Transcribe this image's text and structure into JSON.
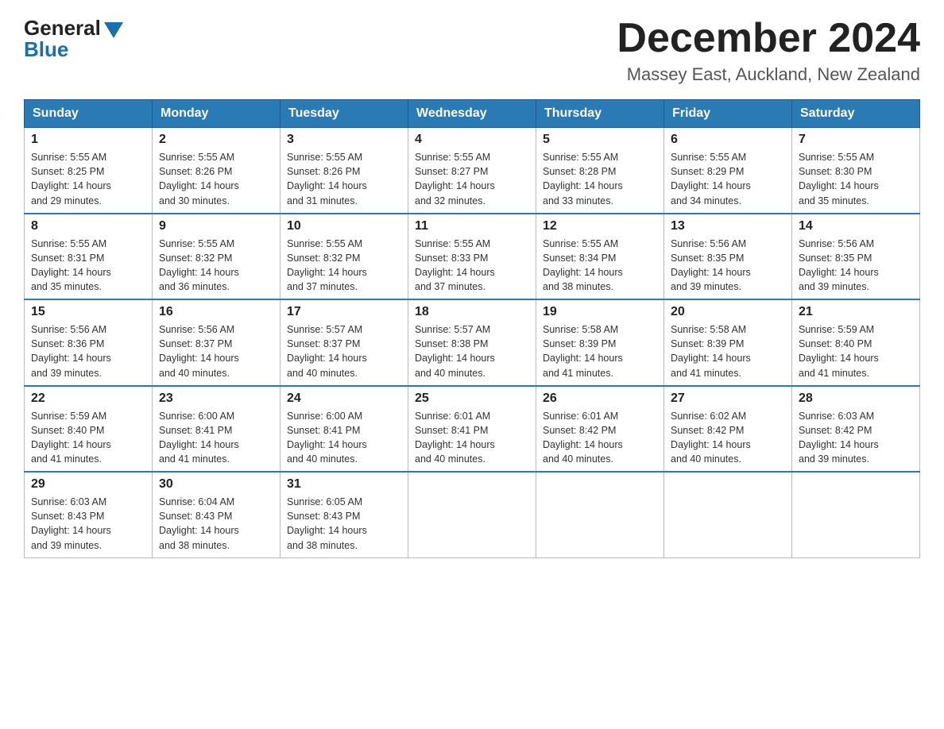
{
  "header": {
    "logo_general": "General",
    "logo_blue": "Blue",
    "main_title": "December 2024",
    "subtitle": "Massey East, Auckland, New Zealand"
  },
  "weekdays": [
    "Sunday",
    "Monday",
    "Tuesday",
    "Wednesday",
    "Thursday",
    "Friday",
    "Saturday"
  ],
  "weeks": [
    [
      {
        "day": "1",
        "sunrise": "5:55 AM",
        "sunset": "8:25 PM",
        "daylight": "14 hours and 29 minutes."
      },
      {
        "day": "2",
        "sunrise": "5:55 AM",
        "sunset": "8:26 PM",
        "daylight": "14 hours and 30 minutes."
      },
      {
        "day": "3",
        "sunrise": "5:55 AM",
        "sunset": "8:26 PM",
        "daylight": "14 hours and 31 minutes."
      },
      {
        "day": "4",
        "sunrise": "5:55 AM",
        "sunset": "8:27 PM",
        "daylight": "14 hours and 32 minutes."
      },
      {
        "day": "5",
        "sunrise": "5:55 AM",
        "sunset": "8:28 PM",
        "daylight": "14 hours and 33 minutes."
      },
      {
        "day": "6",
        "sunrise": "5:55 AM",
        "sunset": "8:29 PM",
        "daylight": "14 hours and 34 minutes."
      },
      {
        "day": "7",
        "sunrise": "5:55 AM",
        "sunset": "8:30 PM",
        "daylight": "14 hours and 35 minutes."
      }
    ],
    [
      {
        "day": "8",
        "sunrise": "5:55 AM",
        "sunset": "8:31 PM",
        "daylight": "14 hours and 35 minutes."
      },
      {
        "day": "9",
        "sunrise": "5:55 AM",
        "sunset": "8:32 PM",
        "daylight": "14 hours and 36 minutes."
      },
      {
        "day": "10",
        "sunrise": "5:55 AM",
        "sunset": "8:32 PM",
        "daylight": "14 hours and 37 minutes."
      },
      {
        "day": "11",
        "sunrise": "5:55 AM",
        "sunset": "8:33 PM",
        "daylight": "14 hours and 37 minutes."
      },
      {
        "day": "12",
        "sunrise": "5:55 AM",
        "sunset": "8:34 PM",
        "daylight": "14 hours and 38 minutes."
      },
      {
        "day": "13",
        "sunrise": "5:56 AM",
        "sunset": "8:35 PM",
        "daylight": "14 hours and 39 minutes."
      },
      {
        "day": "14",
        "sunrise": "5:56 AM",
        "sunset": "8:35 PM",
        "daylight": "14 hours and 39 minutes."
      }
    ],
    [
      {
        "day": "15",
        "sunrise": "5:56 AM",
        "sunset": "8:36 PM",
        "daylight": "14 hours and 39 minutes."
      },
      {
        "day": "16",
        "sunrise": "5:56 AM",
        "sunset": "8:37 PM",
        "daylight": "14 hours and 40 minutes."
      },
      {
        "day": "17",
        "sunrise": "5:57 AM",
        "sunset": "8:37 PM",
        "daylight": "14 hours and 40 minutes."
      },
      {
        "day": "18",
        "sunrise": "5:57 AM",
        "sunset": "8:38 PM",
        "daylight": "14 hours and 40 minutes."
      },
      {
        "day": "19",
        "sunrise": "5:58 AM",
        "sunset": "8:39 PM",
        "daylight": "14 hours and 41 minutes."
      },
      {
        "day": "20",
        "sunrise": "5:58 AM",
        "sunset": "8:39 PM",
        "daylight": "14 hours and 41 minutes."
      },
      {
        "day": "21",
        "sunrise": "5:59 AM",
        "sunset": "8:40 PM",
        "daylight": "14 hours and 41 minutes."
      }
    ],
    [
      {
        "day": "22",
        "sunrise": "5:59 AM",
        "sunset": "8:40 PM",
        "daylight": "14 hours and 41 minutes."
      },
      {
        "day": "23",
        "sunrise": "6:00 AM",
        "sunset": "8:41 PM",
        "daylight": "14 hours and 41 minutes."
      },
      {
        "day": "24",
        "sunrise": "6:00 AM",
        "sunset": "8:41 PM",
        "daylight": "14 hours and 40 minutes."
      },
      {
        "day": "25",
        "sunrise": "6:01 AM",
        "sunset": "8:41 PM",
        "daylight": "14 hours and 40 minutes."
      },
      {
        "day": "26",
        "sunrise": "6:01 AM",
        "sunset": "8:42 PM",
        "daylight": "14 hours and 40 minutes."
      },
      {
        "day": "27",
        "sunrise": "6:02 AM",
        "sunset": "8:42 PM",
        "daylight": "14 hours and 40 minutes."
      },
      {
        "day": "28",
        "sunrise": "6:03 AM",
        "sunset": "8:42 PM",
        "daylight": "14 hours and 39 minutes."
      }
    ],
    [
      {
        "day": "29",
        "sunrise": "6:03 AM",
        "sunset": "8:43 PM",
        "daylight": "14 hours and 39 minutes."
      },
      {
        "day": "30",
        "sunrise": "6:04 AM",
        "sunset": "8:43 PM",
        "daylight": "14 hours and 38 minutes."
      },
      {
        "day": "31",
        "sunrise": "6:05 AM",
        "sunset": "8:43 PM",
        "daylight": "14 hours and 38 minutes."
      },
      null,
      null,
      null,
      null
    ]
  ],
  "labels": {
    "sunrise": "Sunrise:",
    "sunset": "Sunset:",
    "daylight": "Daylight: 14 hours"
  }
}
